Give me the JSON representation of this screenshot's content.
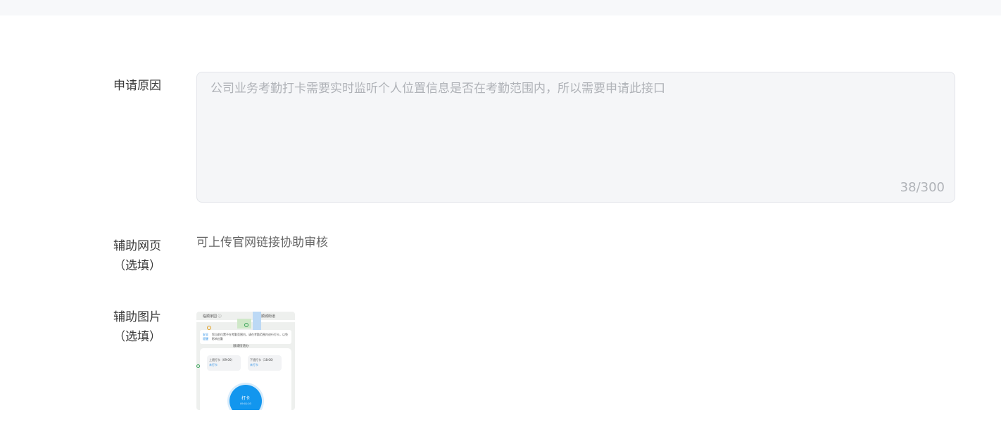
{
  "form": {
    "reason": {
      "label": "申请原因",
      "value": "公司业务考勤打卡需要实时监听个人位置信息是否在考勤范围内，所以需要申请此接口",
      "counter": "38/300"
    },
    "webpage": {
      "label_line1": "辅助网页",
      "label_line2": "（选填）",
      "hint": "可上传官网链接协助审核"
    },
    "image": {
      "label_line1": "辅助图片",
      "label_line2": "（选填）",
      "thumbnail": {
        "map_label_left": "临顺家园 ⓘ",
        "map_label_right": "顺城街道",
        "banner_tag": "安全提醒",
        "banner_text": "您当前位置不在考勤范围内，请在考勤范围内进行打卡，以免影响出勤",
        "map_label_center": "顺城街道办",
        "pill_left_title": "上班打卡（09:00）",
        "pill_left_status": "未打卡",
        "pill_right_title": "下班打卡（18:00）",
        "pill_right_status": "未打卡",
        "punch_label": "打卡",
        "punch_time": "09:01:03"
      }
    }
  },
  "colors": {
    "page_bg": "#ffffff",
    "topbar_bg": "#f7f8fa",
    "input_bg": "#f5f6f8",
    "placeholder": "#b0b3b8",
    "accent_blue": "#1296ee"
  }
}
